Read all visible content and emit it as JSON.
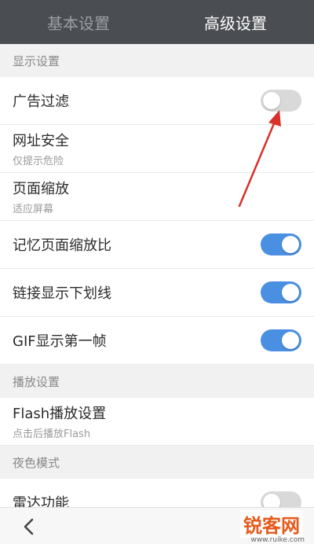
{
  "tabs": [
    {
      "label": "基本设置",
      "active": false
    },
    {
      "label": "高级设置",
      "active": true
    }
  ],
  "sections": {
    "display": "显示设置",
    "playback": "播放设置",
    "night": "夜色模式"
  },
  "rows": {
    "ad_filter": {
      "label": "广告过滤",
      "toggle": "off"
    },
    "url_security": {
      "label": "网址安全",
      "sub": "仅提示危险"
    },
    "page_zoom": {
      "label": "页面缩放",
      "sub": "适应屏幕"
    },
    "remember_zoom": {
      "label": "记忆页面缩放比",
      "toggle": "on"
    },
    "link_underline": {
      "label": "链接显示下划线",
      "toggle": "on"
    },
    "gif_first_frame": {
      "label": "GIF显示第一帧",
      "toggle": "on"
    },
    "flash_settings": {
      "label": "Flash播放设置",
      "sub": "点击后播放Flash"
    },
    "radar": {
      "label": "雷达功能"
    }
  },
  "icons": {
    "back": "chevron-left-icon",
    "annotation": "red-arrow-icon"
  },
  "colors": {
    "tab_bar": "#4a4d52",
    "toggle_on": "#4a90e2",
    "toggle_off": "#d9d9d9",
    "annotation": "#d9302a"
  },
  "watermark": {
    "brand": "锐客网",
    "url": "www.ruike.com"
  }
}
